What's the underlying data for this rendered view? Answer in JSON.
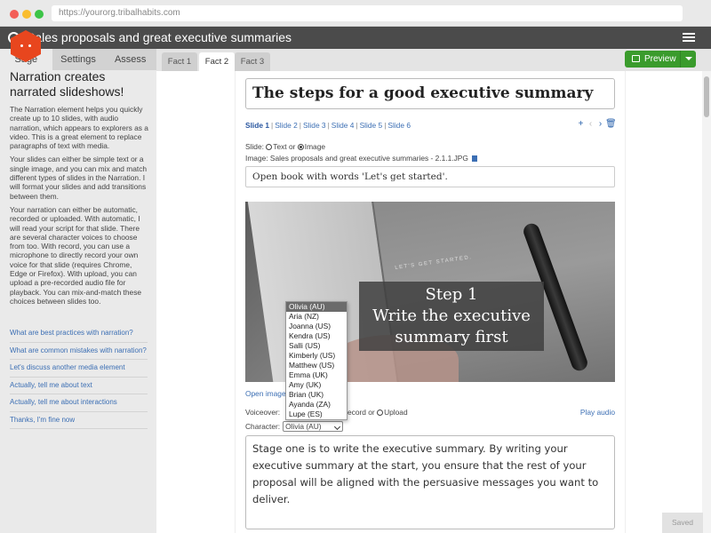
{
  "browser": {
    "url": "https://yourorg.tribalhabits.com"
  },
  "app": {
    "title": "Sales proposals and great executive summaries"
  },
  "left_panel": {
    "tabs": [
      "Sage",
      "Settings",
      "Assess"
    ],
    "heading": "Narration creates narrated slideshows!",
    "paragraphs": [
      "The Narration element helps you quickly create up to 10 slides, with audio narration, which appears to explorers as a video. This is a great element to replace paragraphs of text with media.",
      "Your slides can either be simple text or a single image, and you can mix and match different types of slides in the Narration. I will format your slides and add transitions between them.",
      "Your narration can either be automatic, recorded or uploaded. With automatic, I will read your script for that slide. There are several character voices to choose from too. With record, you can use a microphone to directly record your own voice for that slide (requires Chrome, Edge or Firefox). With upload, you can upload a pre-recorded audio file for playback. You can mix-and-match these choices between slides too."
    ],
    "links": [
      "What are best practices with narration?",
      "What are common mistakes with narration?",
      "Let's discuss another media element",
      "Actually, tell me about text",
      "Actually, tell me about interactions",
      "Thanks, I'm fine now"
    ]
  },
  "content_tabs": [
    "Fact 1",
    "Fact 2",
    "Fact 3"
  ],
  "preview_label": "Preview",
  "editor": {
    "heading": "The steps for a good executive summary",
    "slides": [
      "Slide 1",
      "Slide 2",
      "Slide 3",
      "Slide 4",
      "Slide 5",
      "Slide 6"
    ],
    "slide_type_label": "Slide:",
    "slide_type_text": "Text or",
    "slide_type_image": "Image",
    "image_label": "Image: Sales proposals and great executive summaries - 2.1.1.JPG",
    "alt_text": "Open book with words 'Let's get started'.",
    "image_caption": "LET'S GET STARTED.",
    "overlay_lines": [
      "Step 1",
      "Write the executive",
      "summary first"
    ],
    "open_image": "Open image",
    "voiceover_label": "Voiceover:",
    "voiceover_rest": "ecord or",
    "upload_label": "Upload",
    "play_audio": "Play audio",
    "character_label": "Character:",
    "character_value": "Olivia (AU)",
    "character_options": [
      "Olivia (AU)",
      "Aria (NZ)",
      "Joanna (US)",
      "Kendra (US)",
      "Salli (US)",
      "Kimberly (US)",
      "Matthew (US)",
      "Emma (UK)",
      "Amy (UK)",
      "Brian (UK)",
      "Ayanda (ZA)",
      "Lupe (ES)"
    ],
    "script": "Stage one is to write the executive summary. By writing your executive summary at the start, you ensure that the rest of your proposal will be aligned with the persuasive messages you want to deliver."
  },
  "status": "Saved"
}
